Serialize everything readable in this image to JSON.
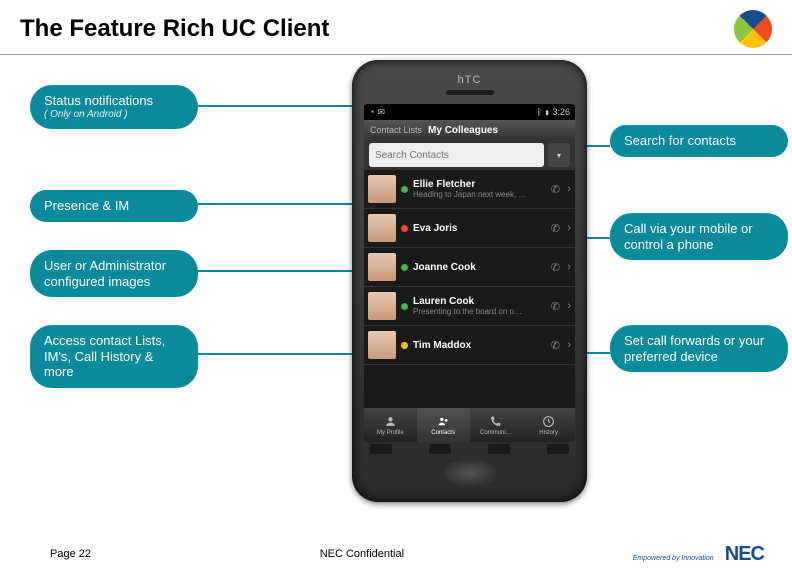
{
  "title": "The Feature Rich UC Client",
  "callouts": {
    "c1": {
      "text": "Status notifications",
      "sub": "( Only on Android )"
    },
    "c2": {
      "text": "Presence & IM"
    },
    "c3": {
      "text": "User or Administrator configured images"
    },
    "c4": {
      "text": "Access contact Lists, IM's, Call History & more"
    },
    "c5": {
      "text": "Search for contacts"
    },
    "c6": {
      "text": "Call via your mobile or control a phone"
    },
    "c7": {
      "text": "Set call forwards or your preferred device"
    }
  },
  "phone": {
    "brand": "hTC",
    "statusbar": {
      "carrier": "",
      "time": "3:26",
      "bt": "⧗",
      "sig": "▰",
      "bat": "▮"
    },
    "titlebar": {
      "label": "Contact Lists",
      "title": "My Colleagues"
    },
    "search_placeholder": "Search Contacts",
    "contacts": [
      {
        "name": "Ellie Fletcher",
        "status": "Heading to Japan next week, …",
        "dot": "g"
      },
      {
        "name": "Eva Joris",
        "status": "",
        "dot": "r"
      },
      {
        "name": "Joanne Cook",
        "status": "",
        "dot": "g"
      },
      {
        "name": "Lauren Cook",
        "status": "Presenting to the board on o…",
        "dot": "g"
      },
      {
        "name": "Tim Maddox",
        "status": "",
        "dot": "y"
      }
    ],
    "tabs": [
      {
        "label": "My Profile"
      },
      {
        "label": "Contacts"
      },
      {
        "label": "Communi…"
      },
      {
        "label": "History"
      }
    ]
  },
  "footer": {
    "page": "Page 22",
    "conf": "NEC Confidential",
    "tag": "Empowered by Innovation",
    "brand": "NEC"
  }
}
